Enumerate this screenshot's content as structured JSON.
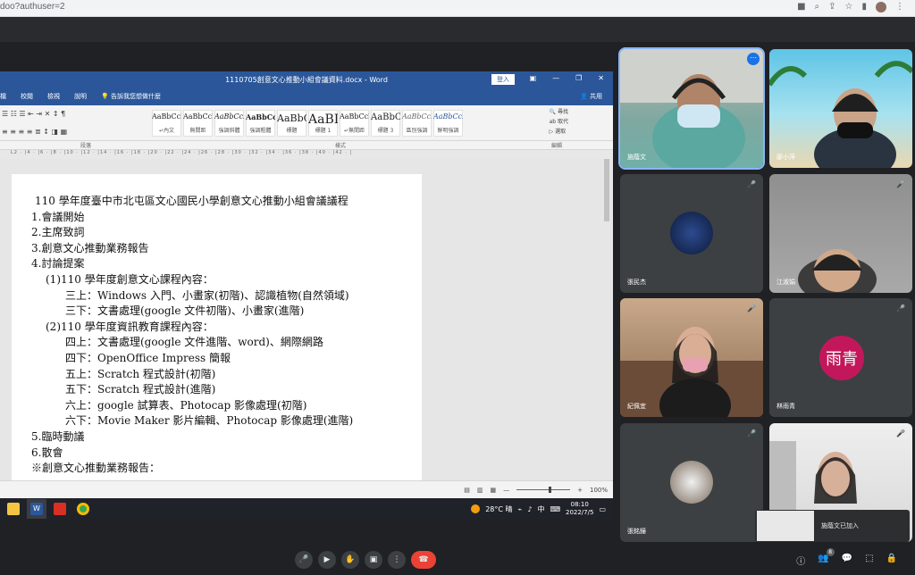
{
  "browser": {
    "url_fragment": "doo?authuser=2"
  },
  "word": {
    "title": "1110705創意文心推動小組會議資料.docx - Word",
    "login_label": "登入",
    "menu": [
      "檔",
      "校閱",
      "檢視",
      "說明",
      "告訴我您想做什麼"
    ],
    "share_label": "共用",
    "styles": [
      {
        "sample": "AaBbCcI",
        "name": "↵內文"
      },
      {
        "sample": "AaBbCcD",
        "name": "無間距"
      },
      {
        "sample": "AaBbCcL",
        "name": "強調斜體"
      },
      {
        "sample": "AaBbCcI",
        "name": "強調粗體"
      },
      {
        "sample": "AaBbC",
        "name": "標題"
      },
      {
        "sample": "AaBI",
        "name": "標題 1"
      },
      {
        "sample": "AaBbCcI",
        "name": "↵無間距"
      },
      {
        "sample": "AaBbCc",
        "name": "標題 3"
      },
      {
        "sample": "AaBbCcL",
        "name": "區別強調"
      },
      {
        "sample": "AaBbCcL",
        "name": "鮮明強調"
      }
    ],
    "edit_group": [
      "尋找",
      "取代",
      "選取"
    ],
    "group_labels": {
      "paragraph": "段落",
      "styles": "樣式",
      "edit": "編輯"
    },
    "ruler_text": "L2 · |4 · |6 · |8 · |10 · |12 · |14 · |16 · |18 · |20 · |22 · |24 · |26 · |28 · |30 · |32 · |34 · |36 · |38 · |40 · |42 · |",
    "doc_lines": [
      "110 學年度臺中市北屯區文心國民小學創意文心推動小組會議議程",
      "1.會議開始",
      "2.主席致詞",
      "3.創意文心推動業務報告",
      "4.討論提案",
      "(1)110 學年度創意文心課程內容：",
      "三上：Windows 入門、小畫家(初階)、認識植物(自然領域)",
      "三下：文書處理(google 文件初階)、小畫家(進階)",
      "(2)110 學年度資訊教育課程內容：",
      "四上：文書處理(google 文件進階、word)、網際網路",
      "四下：OpenOffice Impress 簡報",
      "五上：Scratch 程式設計(初階)",
      "五下：Scratch 程式設計(進階)",
      "六上：google 試算表、Photocap 影像處理(初階)",
      "六下：Movie Maker 影片編輯、Photocap 影像處理(進階)",
      "5.臨時動議",
      "6.散會",
      "※創意文心推動業務報告："
    ],
    "zoom": "100%"
  },
  "taskbar": {
    "temperature": "28°C 晴",
    "ime": "中",
    "time": "08:10",
    "date": "2022/7/5"
  },
  "tiles": [
    {
      "name": "施蔭文",
      "kind": "video"
    },
    {
      "name": "廖小萍",
      "kind": "video"
    },
    {
      "name": "張民杰",
      "kind": "avatar"
    },
    {
      "name": "江淑娟",
      "kind": "video"
    },
    {
      "name": "紀佩宜",
      "kind": "video"
    },
    {
      "name": "林雨青",
      "kind": "initials",
      "initials": "雨青"
    },
    {
      "name": "張銘鐘",
      "kind": "avatar"
    },
    {
      "name": "",
      "kind": "video"
    }
  ],
  "toast": {
    "text": "施蔭文已加入"
  },
  "participant_count": "8",
  "colors": {
    "word_blue": "#2b579a",
    "meet_bg": "#202124",
    "tile_bg": "#3c4043",
    "end_call": "#ea4335",
    "initials_bg": "#c2185b"
  }
}
